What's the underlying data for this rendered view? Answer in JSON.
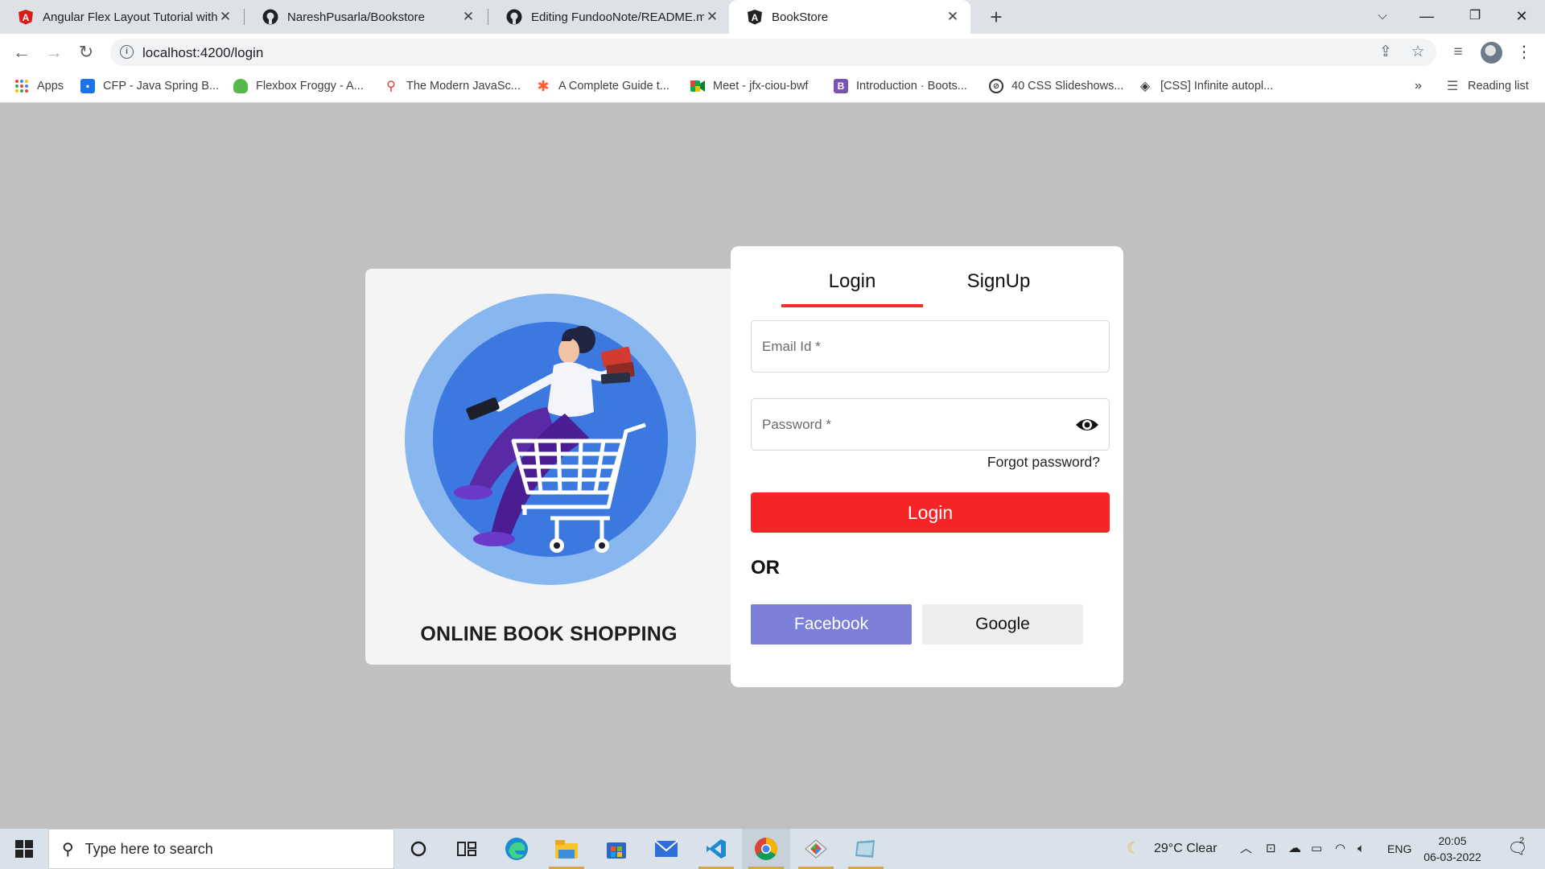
{
  "browser": {
    "tabs": [
      {
        "title": "Angular Flex Layout Tutorial with",
        "icon": "angular-red-icon",
        "active": false
      },
      {
        "title": "NareshPusarla/Bookstore",
        "icon": "github-icon",
        "active": false
      },
      {
        "title": "Editing FundooNote/README.md",
        "icon": "github-icon",
        "active": false
      },
      {
        "title": "BookStore",
        "icon": "angular-black-icon",
        "active": true
      }
    ],
    "close_glyph": "✕",
    "new_tab_glyph": "+",
    "url": "localhost:4200/login",
    "bookmarks": [
      {
        "label": "Apps"
      },
      {
        "label": "CFP - Java Spring B..."
      },
      {
        "label": "Flexbox Froggy - A..."
      },
      {
        "label": "The Modern JavaSc..."
      },
      {
        "label": "A Complete Guide t..."
      },
      {
        "label": "Meet - jfx-ciou-bwf"
      },
      {
        "label": "Introduction · Boots..."
      },
      {
        "label": "40 CSS Slideshows..."
      },
      {
        "label": "[CSS] Infinite autopl..."
      }
    ],
    "bookmarks_overflow": "»",
    "reading_list": "Reading list"
  },
  "page": {
    "left": {
      "title": "ONLINE BOOK SHOPPING"
    },
    "tabs": {
      "login": "Login",
      "signup": "SignUp",
      "active": "login"
    },
    "email_label": "Email Id *",
    "password_label": "Password *",
    "forgot": "Forgot password?",
    "login_button": "Login",
    "or": "OR",
    "facebook": "Facebook",
    "google": "Google",
    "colors": {
      "accent_red": "#f62424",
      "facebook": "#7b7fd7",
      "google_bg": "#eeeeee",
      "page_bg": "#c0c0c0"
    }
  },
  "taskbar": {
    "search_placeholder": "Type here to search",
    "weather": "29°C  Clear",
    "language": "ENG",
    "time": "20:05",
    "date": "06-03-2022",
    "notification_count": "2"
  }
}
